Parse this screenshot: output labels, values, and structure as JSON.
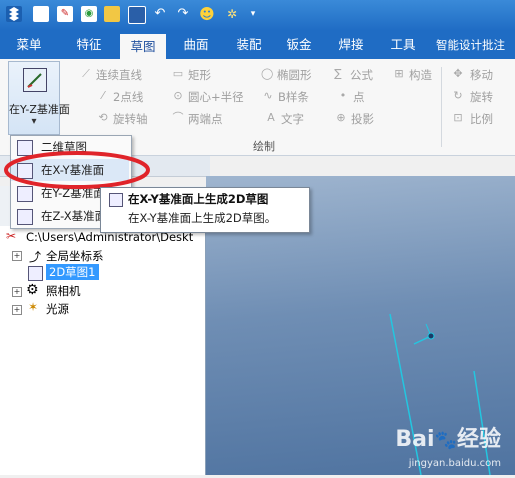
{
  "quick_access": {
    "icons": [
      "app-logo-icon",
      "new-file-icon",
      "new-drawing-icon",
      "open-icon",
      "open-folder-icon",
      "save-icon",
      "undo-icon",
      "redo-icon",
      "smart-icon",
      "sparkle-icon",
      "dropdown-arrow-icon"
    ]
  },
  "menubar": {
    "tabs": [
      {
        "label": "菜单"
      },
      {
        "label": "特征"
      },
      {
        "label": "草图",
        "active": true
      },
      {
        "label": "曲面"
      },
      {
        "label": "装配"
      },
      {
        "label": "钣金"
      },
      {
        "label": "焊接"
      },
      {
        "label": "工具"
      },
      {
        "label": "智能设计批注"
      }
    ]
  },
  "ribbon": {
    "big_button": {
      "label": "在Y-Z基准面",
      "arrow": "▾"
    },
    "draw_group_label": "绘制",
    "items": {
      "line": "连续直线",
      "rect": "矩形",
      "ellipse": "椭圆形",
      "formula": "公式",
      "construct": "构造",
      "move": "移动",
      "twopoint_line": "2点线",
      "circle": "圆心+半径",
      "bspline": "B样条",
      "point": "点",
      "rotate": "旋转",
      "rotate_axis": "旋转轴",
      "two_pt_arc": "两端点",
      "text": "文字",
      "project": "投影",
      "scale": "比例"
    }
  },
  "dropdown_menu": {
    "items": [
      {
        "label": "二维草图"
      },
      {
        "label": "在X-Y基准面"
      },
      {
        "label": "在Y-Z基准面"
      },
      {
        "label": "在Z-X基准面"
      }
    ]
  },
  "tooltip": {
    "title": "在X-Y基准面上生成2D草图",
    "desc": "在X-Y基准面上生成2D草图。"
  },
  "tree": {
    "root": "C:\\Users\\Administrator\\Deskt",
    "nodes": [
      {
        "label": "全局坐标系"
      },
      {
        "label": "2D草图1",
        "selected": true
      },
      {
        "label": "照相机"
      },
      {
        "label": "光源"
      }
    ]
  },
  "watermark": {
    "brand": "Bai",
    "brand2": "经验",
    "url": "jingyan.baidu.com"
  },
  "colors": {
    "accent": "#1f6cc4",
    "highlight_circle": "#e0242a",
    "canvas": "#5f7fa8",
    "axis": "#23c6e0"
  }
}
